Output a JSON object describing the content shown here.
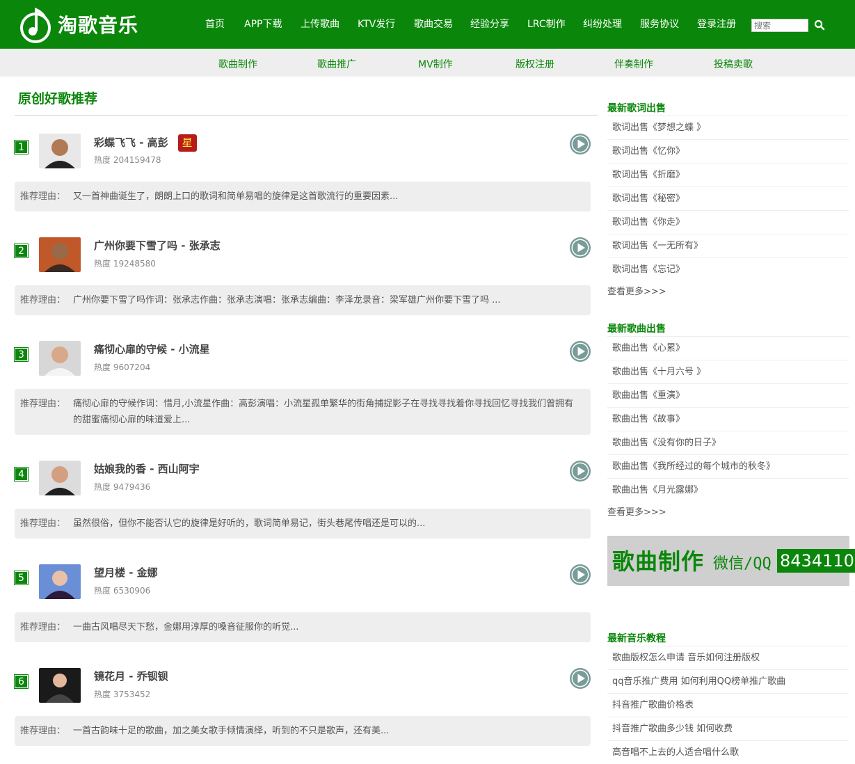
{
  "brand": {
    "name": "淘歌音乐"
  },
  "nav": [
    "首页",
    "APP下载",
    "上传歌曲",
    "KTV发行",
    "歌曲交易",
    "经验分享",
    "LRC制作",
    "纠纷处理",
    "服务协议",
    "登录注册"
  ],
  "search": {
    "placeholder": "搜索"
  },
  "subnav": [
    "歌曲制作",
    "歌曲推广",
    "MV制作",
    "版权注册",
    "伴奏制作",
    "投稿卖歌"
  ],
  "main": {
    "title": "原创好歌推荐",
    "reason_label": "推荐理由：",
    "songs": [
      {
        "rank": "1",
        "title": "彩蝶飞飞 - 高彭",
        "badge": "星",
        "heat": "热度 204159478",
        "reason": "又一首神曲诞生了，朗朗上口的歌词和简单易唱的旋律是这首歌流行的重要因素..."
      },
      {
        "rank": "2",
        "title": "广州你要下雪了吗 - 张承志",
        "heat": "热度 19248580",
        "reason": "广州你要下雪了吗作词：张承志作曲：张承志演唱：张承志编曲：李泽龙录音：梁军雄广州你要下雪了吗 ..."
      },
      {
        "rank": "3",
        "title": "痛彻心扉的守候 - 小流星",
        "heat": "热度 9607204",
        "reason": "痛彻心扉的守候作词：惜月,小流星作曲：高彭演唱：小流星孤单繁华的街角捕捉影子在寻找寻找着你寻找回忆寻找我们曾拥有的甜蜜痛彻心扉的味道爱上..."
      },
      {
        "rank": "4",
        "title": "姑娘我的香 - 西山阿宇",
        "heat": "热度 9479436",
        "reason": "虽然很俗，但你不能否认它的旋律是好听的，歌词简单易记，街头巷尾传唱还是可以的..."
      },
      {
        "rank": "5",
        "title": "望月楼 - 金娜",
        "heat": "热度 6530906",
        "reason": "一曲古风唱尽天下愁，金娜用淳厚的嗓音征服你的听觉..."
      },
      {
        "rank": "6",
        "title": "镜花月 - 乔钡钡",
        "heat": "热度 3753452",
        "reason": "一首古韵味十足的歌曲，加之美女歌手倾情演绎，听到的不只是歌声，还有美..."
      }
    ]
  },
  "sidebar": {
    "lyrics": {
      "title": "最新歌词出售",
      "items": [
        "歌词出售《梦想之蝶 》",
        "歌词出售《忆你》",
        "歌词出售《折磨》",
        "歌词出售《秘密》",
        "歌词出售《你走》",
        "歌词出售《一无所有》",
        "歌词出售《忘记》"
      ],
      "more": "查看更多>>>"
    },
    "songs": {
      "title": "最新歌曲出售",
      "items": [
        "歌曲出售《心累》",
        "歌曲出售《十月六号 》",
        "歌曲出售《重演》",
        "歌曲出售《故事》",
        "歌曲出售《没有你的日子》",
        "歌曲出售《我所经过的每个城市的秋冬》",
        "歌曲出售《月光露娜》"
      ],
      "more": "查看更多>>>"
    },
    "ad": {
      "main": "歌曲制作",
      "wechat": "微信/QQ",
      "qq": "8434110"
    },
    "tutorials": {
      "title": "最新音乐教程",
      "items": [
        "歌曲版权怎么申请 音乐如何注册版权",
        "qq音乐推广费用 如何利用QQ榜单推广歌曲",
        "抖音推广歌曲价格表",
        "抖音推广歌曲多少钱 如何收费",
        "高音唱不上去的人适合唱什么歌"
      ]
    }
  },
  "colors": {
    "brand_green": "#0a870a",
    "badge_red": "#b71c1c",
    "play_gray": "#789c98"
  }
}
